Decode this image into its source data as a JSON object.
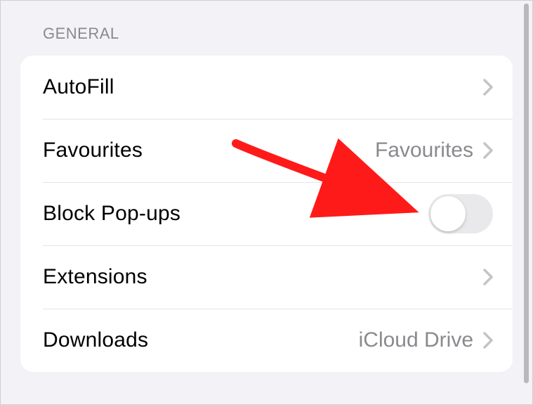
{
  "section": {
    "header": "GENERAL",
    "rows": {
      "autofill": {
        "label": "AutoFill"
      },
      "favourites": {
        "label": "Favourites",
        "detail": "Favourites"
      },
      "block_popups": {
        "label": "Block Pop-ups",
        "toggle_on": false
      },
      "extensions": {
        "label": "Extensions"
      },
      "downloads": {
        "label": "Downloads",
        "detail": "iCloud Drive"
      }
    }
  }
}
